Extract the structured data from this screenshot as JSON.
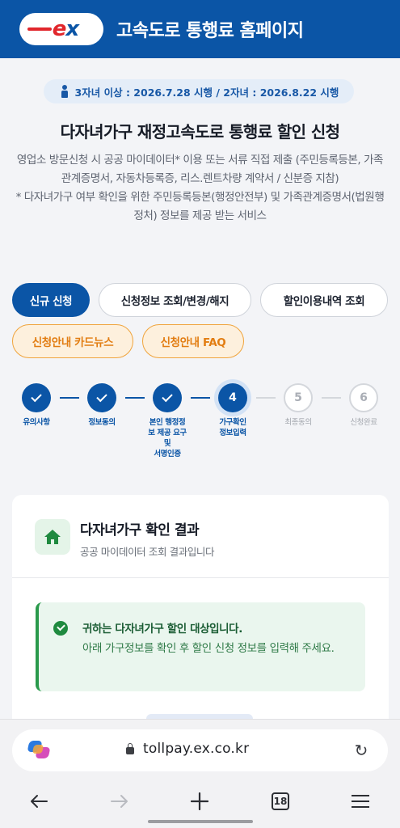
{
  "header": {
    "logo_text_e": "e",
    "logo_text_x": "x",
    "title": "고속도로 통행료 홈페이지"
  },
  "notice": {
    "text": "3자녀 이상 : 2026.7.28 시행 / 2자녀 : 2026.8.22 시행"
  },
  "page": {
    "title": "다자녀가구 재정고속도로 통행료 할인 신청",
    "desc_line1": "영업소 방문신청 시 공공 마이데이터* 이용 또는 서류 직접 제출 (주민등록등본, 가족관계증명서, 자동차등록증, 리스.렌트차량 계약서 / 신분증 지참)",
    "desc_line2": "* 다자녀가구 여부 확인을 위한 주민등록등본(행정안전부) 및 가족관계증명서(법원행정처) 정보를 제공 받는 서비스"
  },
  "tabs": {
    "new": "신규 신청",
    "manage": "신청정보 조회/변경/해지",
    "history": "할인이용내역 조회",
    "cardnews": "신청안내 카드뉴스",
    "faq": "신청안내 FAQ"
  },
  "steps": [
    {
      "number": "1",
      "label": "유의사항",
      "state": "done"
    },
    {
      "number": "2",
      "label": "정보동의",
      "state": "done"
    },
    {
      "number": "3",
      "label_lines": [
        "본인 행정정",
        "보 제공 요구",
        "및",
        "서명인증"
      ],
      "state": "done"
    },
    {
      "number": "4",
      "label_lines": [
        "가구확인",
        "정보입력"
      ],
      "state": "active"
    },
    {
      "number": "5",
      "label": "최종동의",
      "state": "todo"
    },
    {
      "number": "6",
      "label": "신청완료",
      "state": "todo"
    }
  ],
  "result": {
    "icon": "home-icon",
    "title": "다자녀가구 확인 결과",
    "subtitle": "공공 마이데이터 조회 결과입니다",
    "alert_title": "귀하는 다자녀가구 할인 대상입니다.",
    "alert_body": "아래 가구정보를 확인 후 할인 신청 정보를 입력해 주세요."
  },
  "browser": {
    "url": "tollpay.ex.co.kr",
    "tab_count": "18"
  },
  "colors": {
    "brand_blue": "#0b55a6",
    "brand_red": "#e1262c",
    "orange": "#f0a43c",
    "success_green": "#2a9a4c"
  }
}
